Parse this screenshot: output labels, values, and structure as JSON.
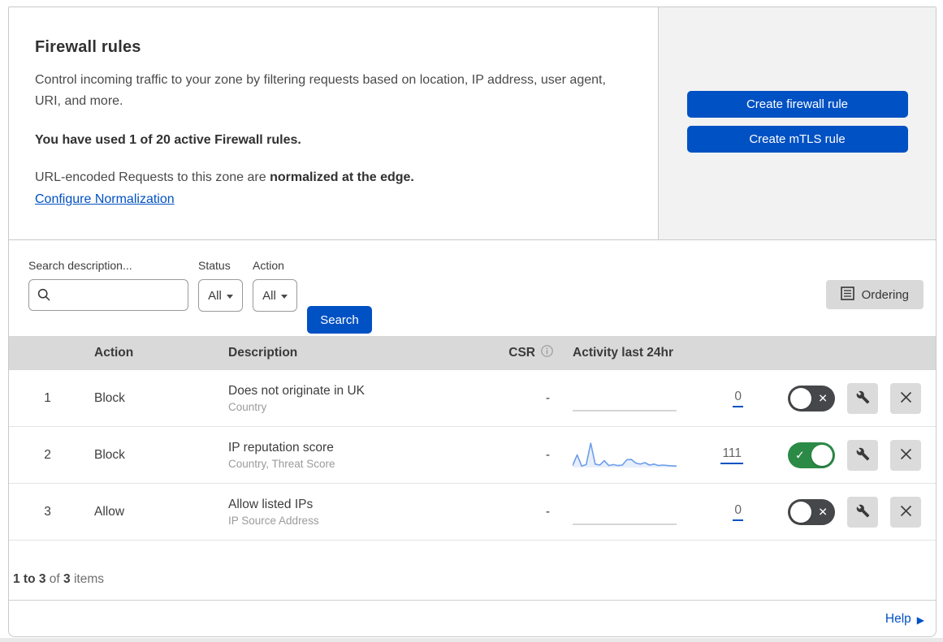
{
  "panel": {
    "title": "Firewall rules",
    "description": "Control incoming traffic to your zone by filtering requests based on location, IP address, user agent, URI, and more.",
    "usage": "You have used 1 of 20 active Firewall rules.",
    "normalization_prefix": "URL-encoded Requests to this zone are ",
    "normalization_bold": "normalized at the edge.",
    "normalization_link": "Configure Normalization",
    "create_firewall_label": "Create firewall rule",
    "create_mtls_label": "Create mTLS rule"
  },
  "filters": {
    "search_label": "Search description...",
    "search_value": "",
    "status_label": "Status",
    "status_value": "All",
    "action_label": "Action",
    "action_value": "All",
    "search_button_label": "Search",
    "ordering_label": "Ordering"
  },
  "table": {
    "headers": {
      "action": "Action",
      "description": "Description",
      "csr": "CSR",
      "activity": "Activity last 24hr"
    },
    "rows": [
      {
        "num": "1",
        "action": "Block",
        "description": "Does not originate in UK",
        "criteria": "Country",
        "csr": "-",
        "activity_count": "0",
        "enabled": false,
        "activity_sparkline": [
          0,
          0,
          0,
          0,
          0,
          0,
          0,
          0,
          0,
          0,
          0,
          0,
          0,
          0,
          0,
          0,
          0,
          0,
          0,
          0,
          0,
          0,
          0,
          0
        ]
      },
      {
        "num": "2",
        "action": "Block",
        "description": "IP reputation score",
        "criteria": "Country, Threat Score",
        "csr": "-",
        "activity_count": "111",
        "enabled": true,
        "activity_sparkline": [
          8,
          52,
          6,
          12,
          100,
          14,
          10,
          28,
          8,
          12,
          8,
          10,
          32,
          33,
          18,
          14,
          20,
          10,
          14,
          8,
          10,
          8,
          7,
          6
        ]
      },
      {
        "num": "3",
        "action": "Allow",
        "description": "Allow listed IPs",
        "criteria": "IP Source Address",
        "csr": "-",
        "activity_count": "0",
        "enabled": false,
        "activity_sparkline": [
          0,
          0,
          0,
          0,
          0,
          0,
          0,
          0,
          0,
          0,
          0,
          0,
          0,
          0,
          0,
          0,
          0,
          0,
          0,
          0,
          0,
          0,
          0,
          0
        ]
      }
    ]
  },
  "footer": {
    "range": "1 to 3",
    "of": " of ",
    "total": "3",
    "items_label": " items",
    "help_label": "Help"
  },
  "colors": {
    "accent_blue": "#0051c3",
    "toggle_on_green": "#2b8a46",
    "toggle_off_gray": "#46474a",
    "sparkline_blue": "#6d9eea",
    "header_band_gray": "#d9d9d9",
    "panel_gray": "#f2f2f2"
  }
}
